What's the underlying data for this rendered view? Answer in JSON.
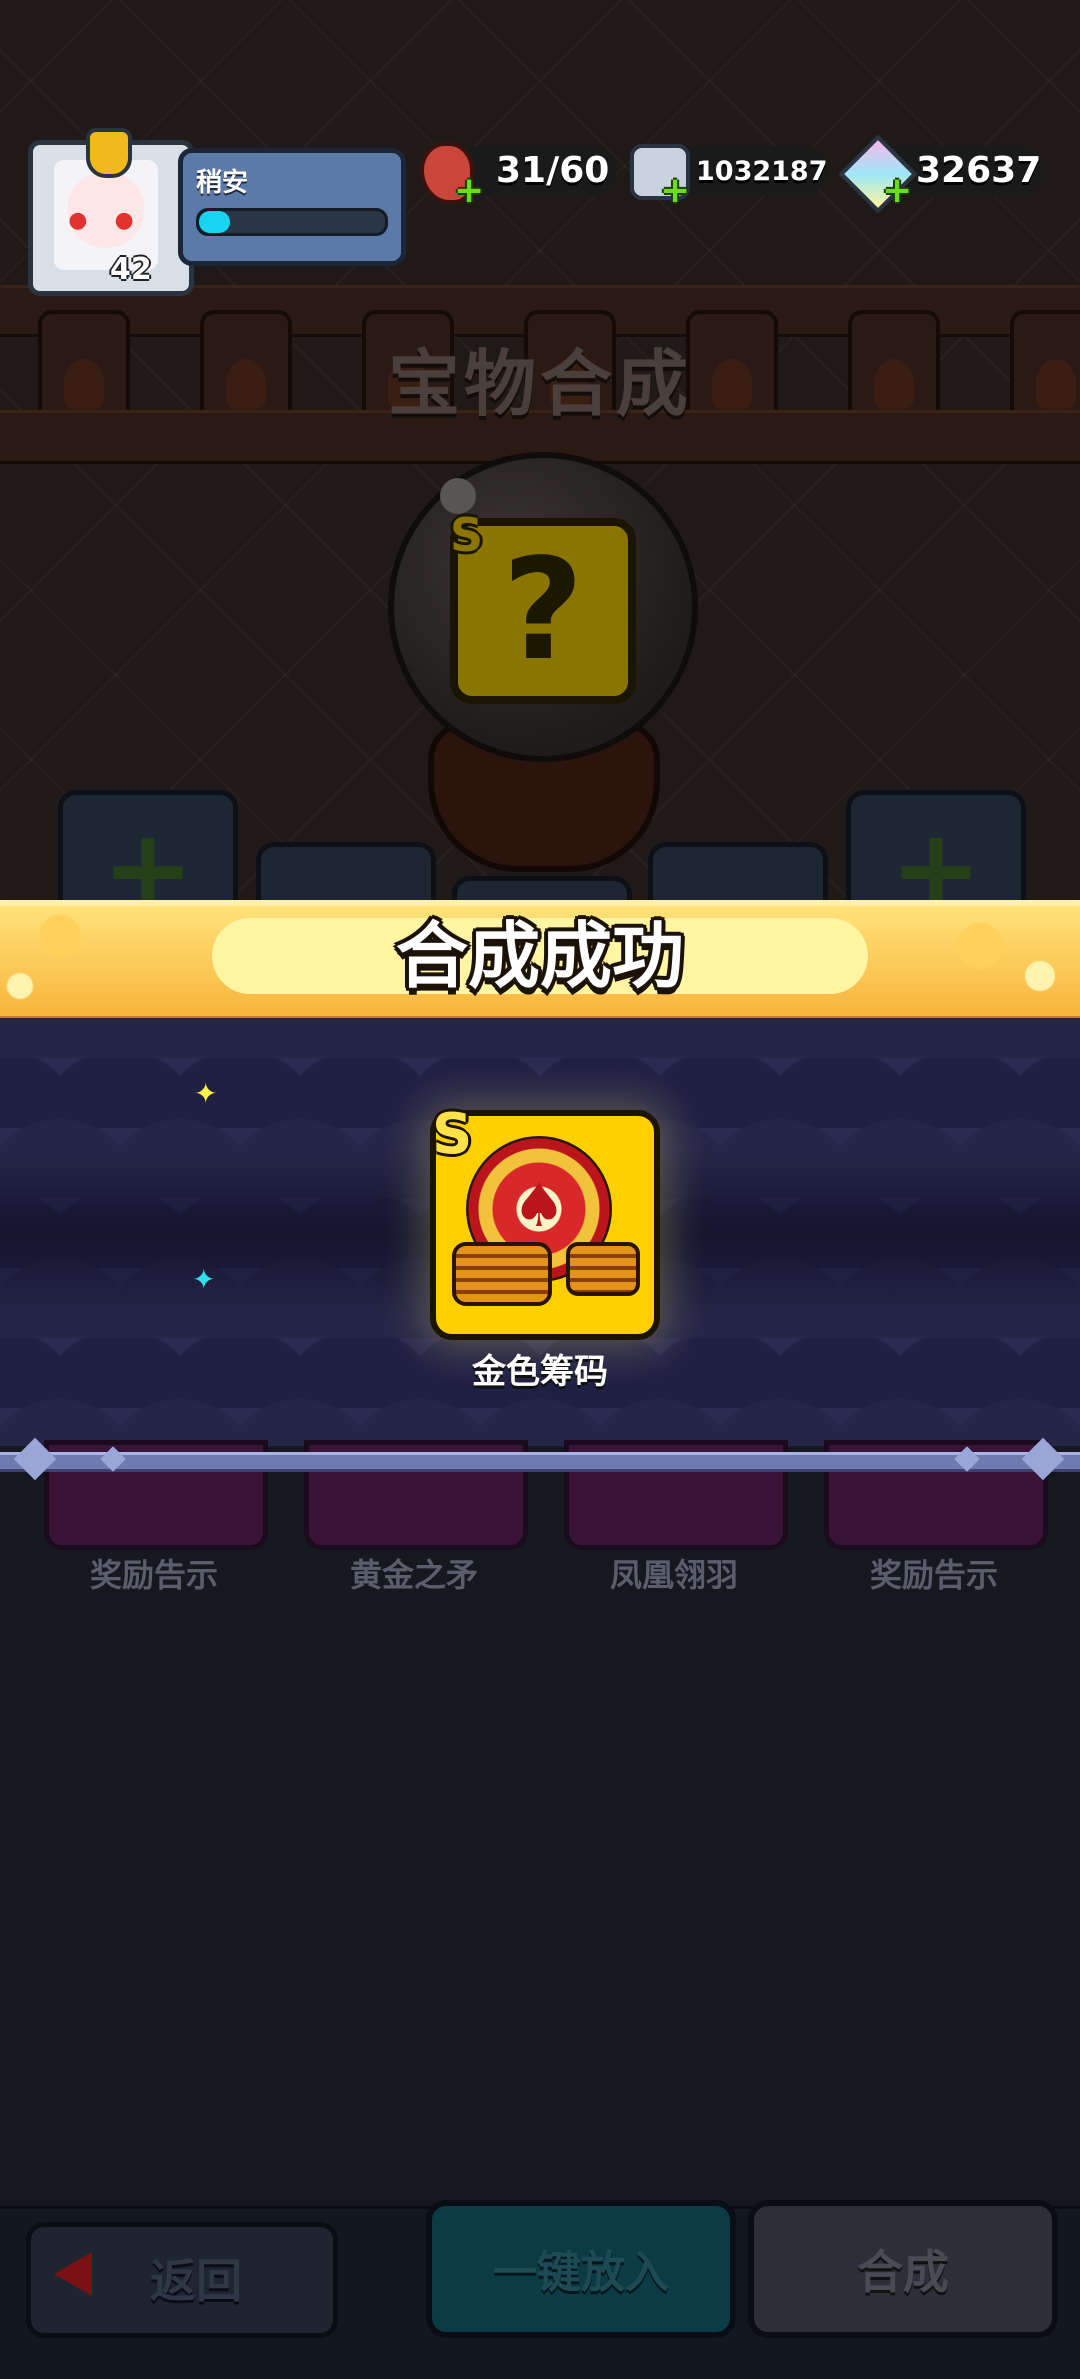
{
  "screen": {
    "title": "宝物合成"
  },
  "player": {
    "name": "稍安",
    "level": "42",
    "xp_fraction": 0.17
  },
  "resources": {
    "stamina": {
      "icon": "meat-icon",
      "value": "31/60"
    },
    "silver": {
      "icon": "silver-ore-icon",
      "value": "1032187"
    },
    "diamonds": {
      "icon": "diamond-icon",
      "value": "32637"
    }
  },
  "synthesis": {
    "placeholder_grade": "S",
    "placeholder_symbol": "?",
    "slot_symbol": "+"
  },
  "popup": {
    "banner_title": "合成成功",
    "reward": {
      "grade": "S",
      "name": "金色筹码",
      "icon": "poker-chip-icon"
    }
  },
  "items": [
    {
      "label": "奖励告示"
    },
    {
      "label": "黄金之矛"
    },
    {
      "label": "凤凰翎羽"
    },
    {
      "label": "奖励告示"
    }
  ],
  "buttons": {
    "back": "返回",
    "put_in": "一键放入",
    "synthesize": "合成"
  },
  "colors": {
    "banner": "#ffd24a",
    "reward_card": "#ffcf00",
    "xp": "#19d4f0",
    "plus": "#6bdc19"
  }
}
